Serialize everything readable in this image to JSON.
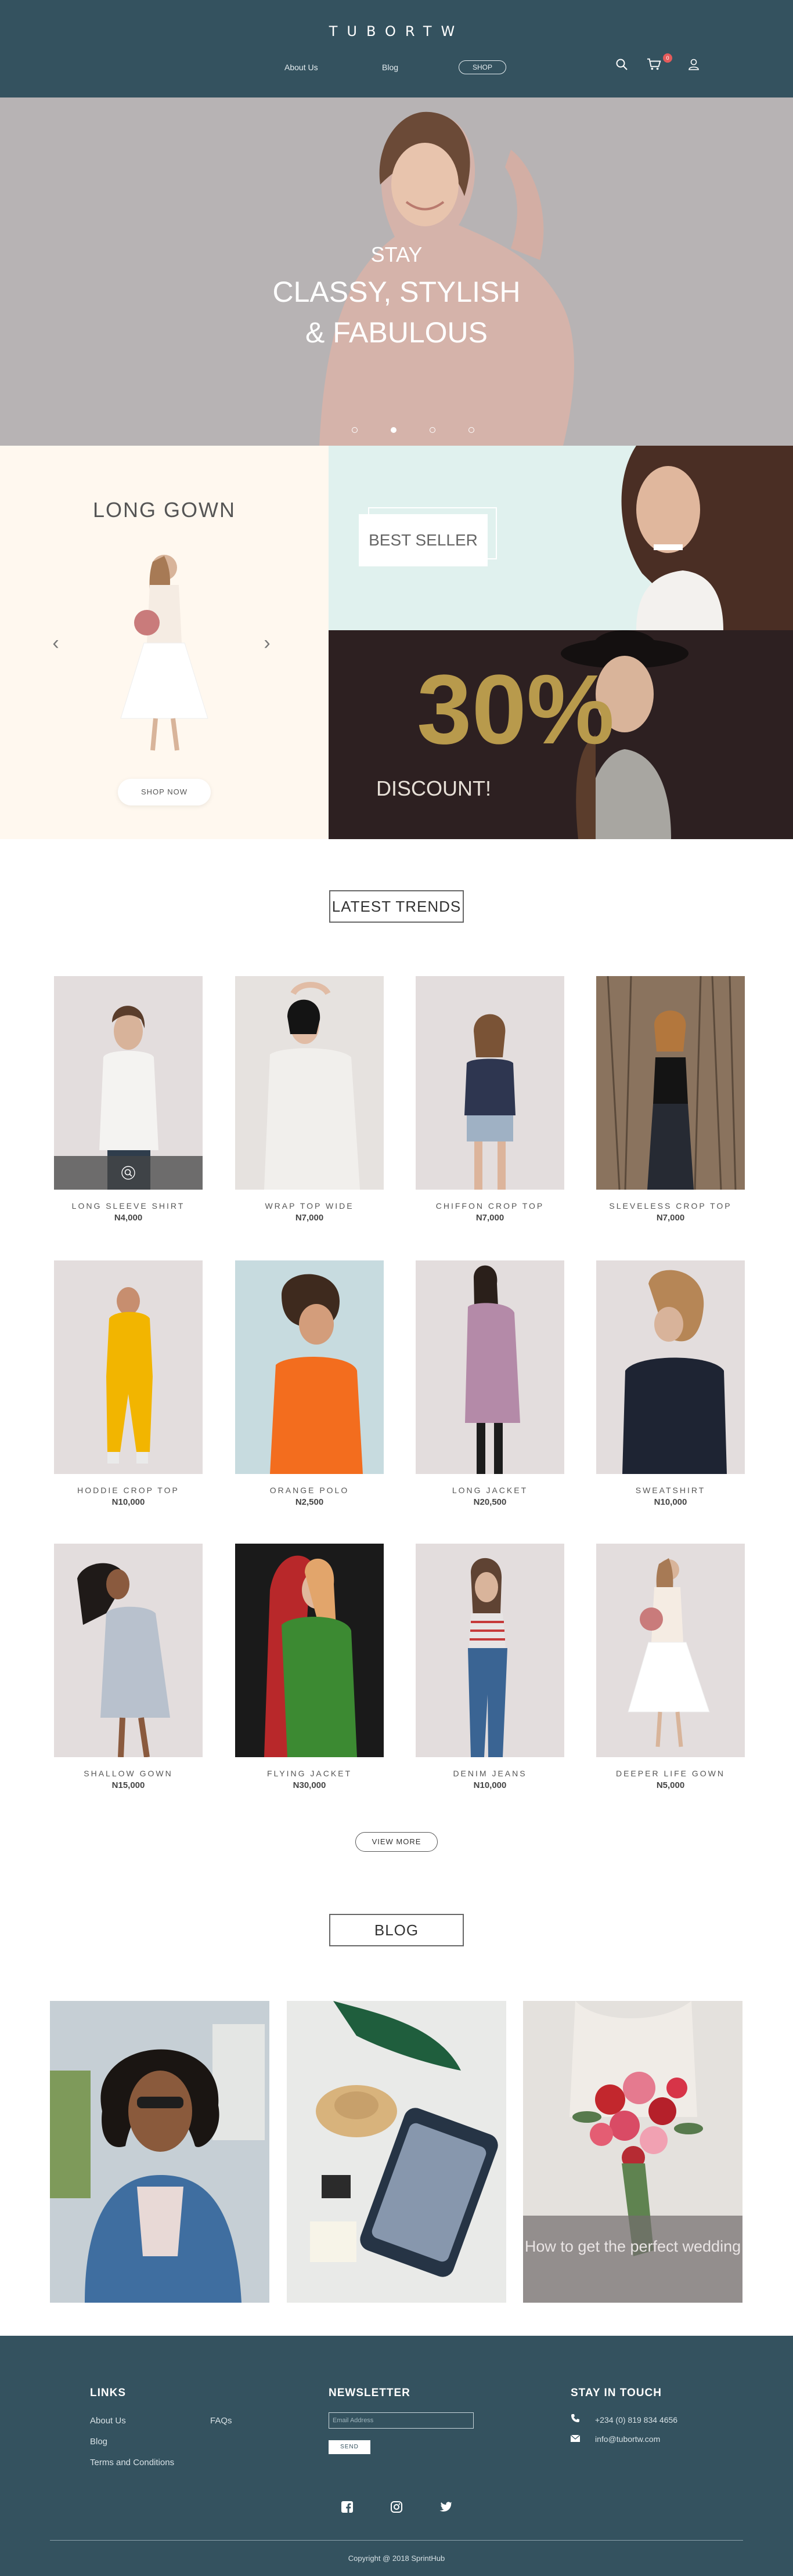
{
  "header": {
    "logo": "TUBORTW",
    "nav": {
      "about": "About Us",
      "blog": "Blog",
      "shop": "SHOP"
    },
    "cart_count": "0",
    "icons": [
      "search-icon",
      "cart-icon",
      "user-icon"
    ]
  },
  "hero": {
    "line_stay": "STAY",
    "line_1": "CLASSY, STYLISH",
    "line_2": "& FABULOUS",
    "slides": 4,
    "active_slide": 2
  },
  "promo": {
    "gown_title": "LONG GOWN",
    "shop_now": "SHOP NOW",
    "best_seller": "BEST SELLER",
    "discount_number": "30%",
    "discount_text": "DISCOUNT!"
  },
  "trends": {
    "title": "LATEST TRENDS",
    "products": [
      {
        "name": "LONG SLEEVE SHIRT",
        "price": "N4,000"
      },
      {
        "name": "WRAP TOP WIDE",
        "price": "N7,000"
      },
      {
        "name": "CHIFFON CROP TOP",
        "price": "N7,000"
      },
      {
        "name": "SLEVELESS CROP TOP",
        "price": "N7,000"
      },
      {
        "name": "HODDIE CROP TOP",
        "price": "N10,000"
      },
      {
        "name": "ORANGE POLO",
        "price": "N2,500"
      },
      {
        "name": "LONG JACKET",
        "price": "N20,500"
      },
      {
        "name": "SWEATSHIRT",
        "price": "N10,000"
      },
      {
        "name": "SHALLOW GOWN",
        "price": "N15,000"
      },
      {
        "name": "FLYING JACKET",
        "price": "N30,000"
      },
      {
        "name": "DENIM JEANS",
        "price": "N10,000"
      },
      {
        "name": "DEEPER LIFE GOWN",
        "price": "N5,000"
      }
    ],
    "view_more": "VIEW MORE"
  },
  "blog": {
    "title": "BLOG",
    "featured_caption": "How to get the perfect wedding"
  },
  "footer": {
    "links_title": "LINKS",
    "links": {
      "about": "About Us",
      "faqs": "FAQs",
      "blog": "Blog",
      "terms": "Terms and Conditions"
    },
    "newsletter_title": "NEWSLETTER",
    "email_placeholder": "Email Address",
    "send": "SEND",
    "touch_title": "STAY IN TOUCH",
    "phone": "+234 (0) 819 834 4656",
    "email": "info@tubortw.com",
    "copyright": "Copyright @ 2018 SprintHub"
  },
  "colors": {
    "header_bg": "#34525f",
    "hero_bg": "#b7b3b4",
    "gown_bg": "#fff8ef",
    "best_seller_bg": "#e0f1ee",
    "discount_bg": "#2d2021",
    "discount_accent": "#b89a4c"
  }
}
